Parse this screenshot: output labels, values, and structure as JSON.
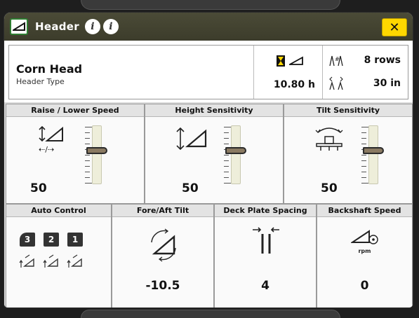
{
  "window": {
    "title": "Header",
    "close_label": "✕"
  },
  "info": {
    "header_type_value": "Corn Head",
    "header_type_label": "Header Type",
    "hours": "10.80 h",
    "rows": "8 rows",
    "row_spacing": "30 in"
  },
  "sections": {
    "raise_lower": {
      "title": "Raise / Lower Speed",
      "value": "50",
      "level": 0.58
    },
    "height_sens": {
      "title": "Height Sensitivity",
      "value": "50",
      "level": 0.58
    },
    "tilt_sens": {
      "title": "Tilt Sensitivity",
      "value": "50",
      "level": 0.58
    },
    "auto_control": {
      "title": "Auto Control",
      "keys": [
        "3",
        "2",
        "1"
      ],
      "active_key": "3"
    },
    "fore_aft": {
      "title": "Fore/Aft Tilt",
      "value": "-10.5"
    },
    "deck_plate": {
      "title": "Deck Plate Spacing",
      "value": "4"
    },
    "backshaft": {
      "title": "Backshaft Speed",
      "value": "0",
      "unit": "rpm"
    }
  },
  "colors": {
    "title_bar": "#45452f",
    "close_button": "#ffd700",
    "accent_green": "#2e7d32"
  }
}
